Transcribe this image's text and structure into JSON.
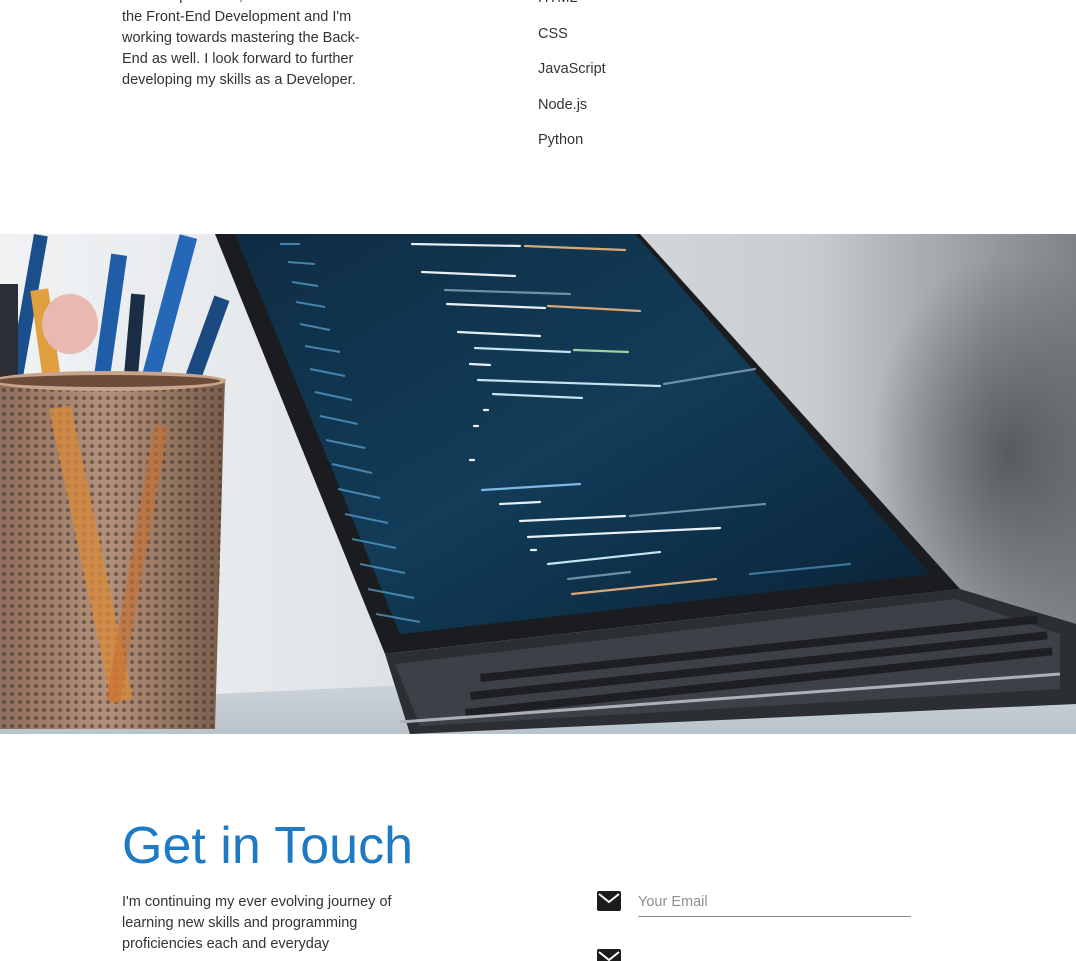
{
  "about": {
    "paragraph": "Bootcamp thus far, I have mastered the Front-End Development and I'm working towards mastering the Back-End as well. I look forward to further developing my skills as a Developer."
  },
  "skills": {
    "items": [
      "HTML",
      "CSS",
      "JavaScript",
      "Node.js",
      "Python"
    ]
  },
  "hero": {
    "image_icon": "laptop-code-photo"
  },
  "contact": {
    "title": "Get in Touch",
    "text": "I'm continuing my ever evolving journey of learning new skills and programming proficiencies each and everyday",
    "email_placeholder": "Your Email",
    "email_icon": "envelope-icon",
    "second_icon": "envelope-icon",
    "accent_color": "#1f7ac4"
  }
}
